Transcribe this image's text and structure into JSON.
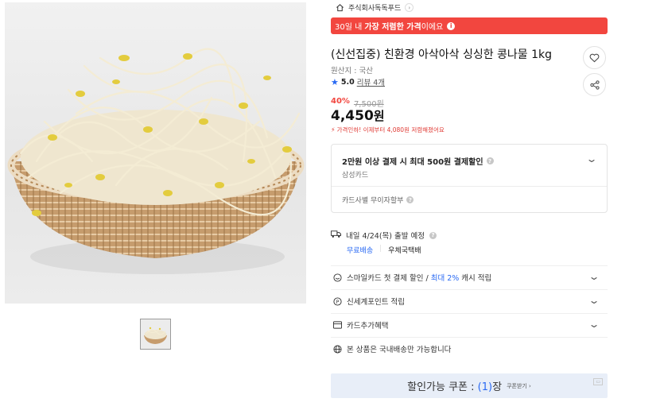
{
  "seller": {
    "name": "주식회사독독푸드",
    "arrow": "›"
  },
  "banner": {
    "pre": "30일 내",
    "highlight": "가장 저렴한 가격",
    "post": "이에요",
    "info": "i"
  },
  "product": {
    "title": "(신선집중) 친환경 아삭아삭 싱싱한 콩나물 1kg",
    "origin": "원산지 : 국산",
    "rating": "5.0",
    "reviews": "리뷰 4개"
  },
  "price": {
    "discount_rate": "40%",
    "original": "7,500원",
    "current": "4,450",
    "unit": "원",
    "drop_note": "가격인하! 이제부터 4,080원 저렴해졌어요"
  },
  "card_benefit": {
    "title": "2만원 이상 결제 시 최대 500원 결제할인",
    "card": "삼성카드",
    "installment": "카드사별 무이자할부",
    "q": "?"
  },
  "shipping": {
    "eta": "내일 4/24(목) 출발 예정",
    "free": "무료배송",
    "carrier": "우체국택배"
  },
  "benefits": [
    {
      "pre": "스마일카드 첫 결제 할인 / ",
      "hl": "최대 2%",
      "post": " 캐시 적립",
      "icon": "smile-card-icon"
    },
    {
      "pre": "신세계포인트 적립",
      "hl": "",
      "post": "",
      "icon": "point-icon"
    },
    {
      "pre": "카드추가혜택",
      "hl": "",
      "post": "",
      "icon": "card-icon"
    },
    {
      "pre": "본 상품은 국내배송만 가능합니다",
      "hl": "",
      "post": "",
      "icon": "globe-icon"
    }
  ],
  "coupon": {
    "label": "할인가능 쿠폰 : ",
    "count": "(1)",
    "suffix": "장",
    "more": "쿠폰받기 ›"
  },
  "colors": {
    "accent_red": "#f2463f",
    "accent_blue": "#2a6af3"
  }
}
